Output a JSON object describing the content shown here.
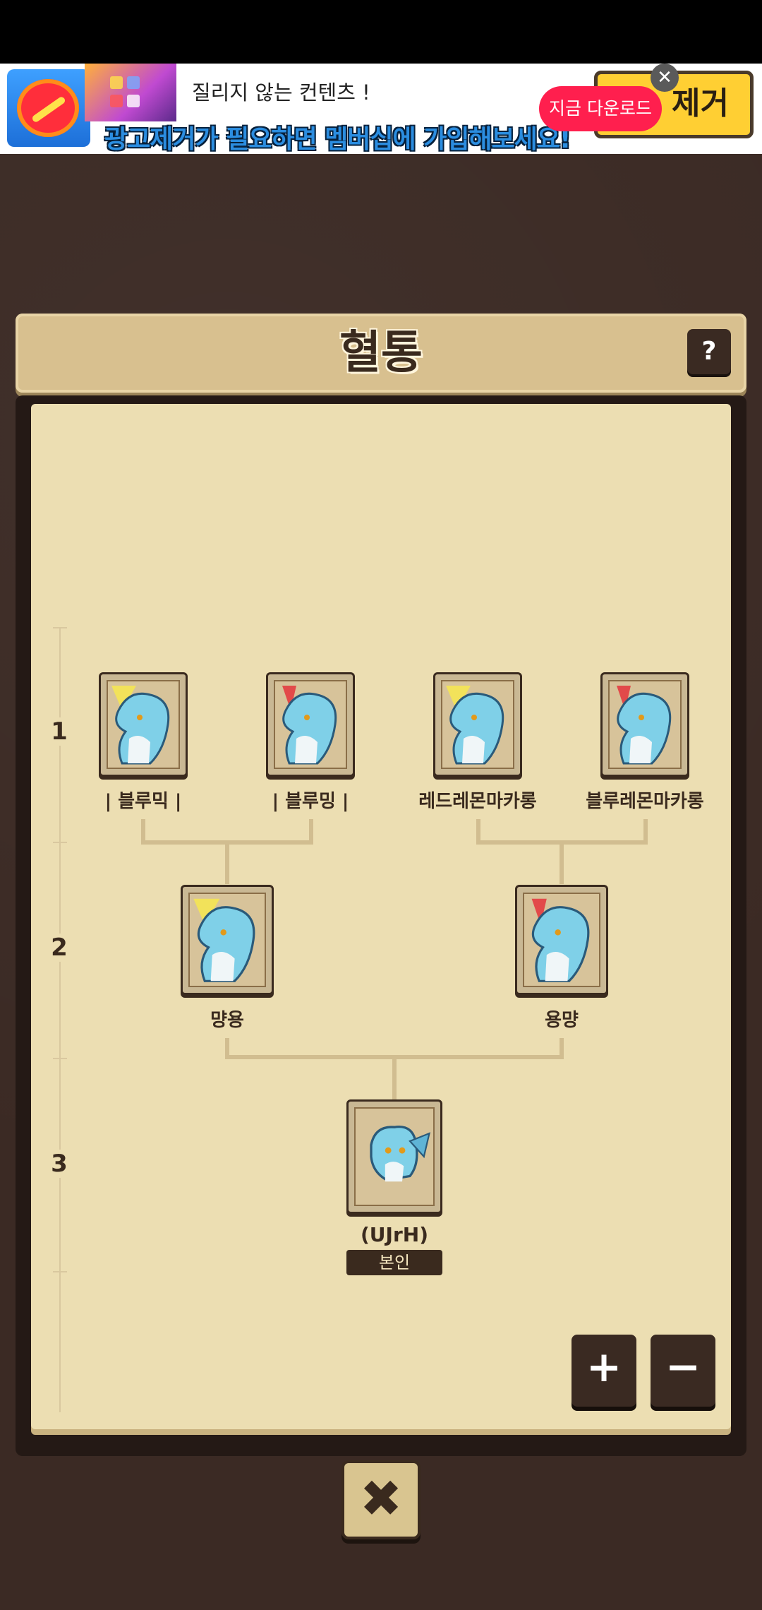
{
  "ad": {
    "headline": "질리지 않는 컨텐츠 !",
    "banner": "광고제거가 필요하면 멤버십에 가입해보세요!",
    "remove_label": "제거",
    "cta_label": "지금 다운로드",
    "close_icon": "close-icon"
  },
  "header": {
    "title": "혈통",
    "help_label": "?"
  },
  "generations": [
    "1",
    "2",
    "3"
  ],
  "gen1": [
    {
      "name": "| 블루믹 |",
      "crest": "yellow"
    },
    {
      "name": "| 블루밍 |",
      "crest": "red"
    },
    {
      "name": "레드레몬마카롱",
      "crest": "yellow"
    },
    {
      "name": "블루레몬마카롱",
      "crest": "red"
    }
  ],
  "gen2": [
    {
      "name": "먕용",
      "crest": "yellow"
    },
    {
      "name": "용먕",
      "crest": "red"
    }
  ],
  "gen3": {
    "name": "(UJrH)",
    "badge": "본인"
  },
  "controls": {
    "zoom_in": "+",
    "zoom_out": "−",
    "close": "✖"
  },
  "colors": {
    "panel": "#ecdeb2",
    "frame": "#241915",
    "accent": "#3a2a1e"
  }
}
